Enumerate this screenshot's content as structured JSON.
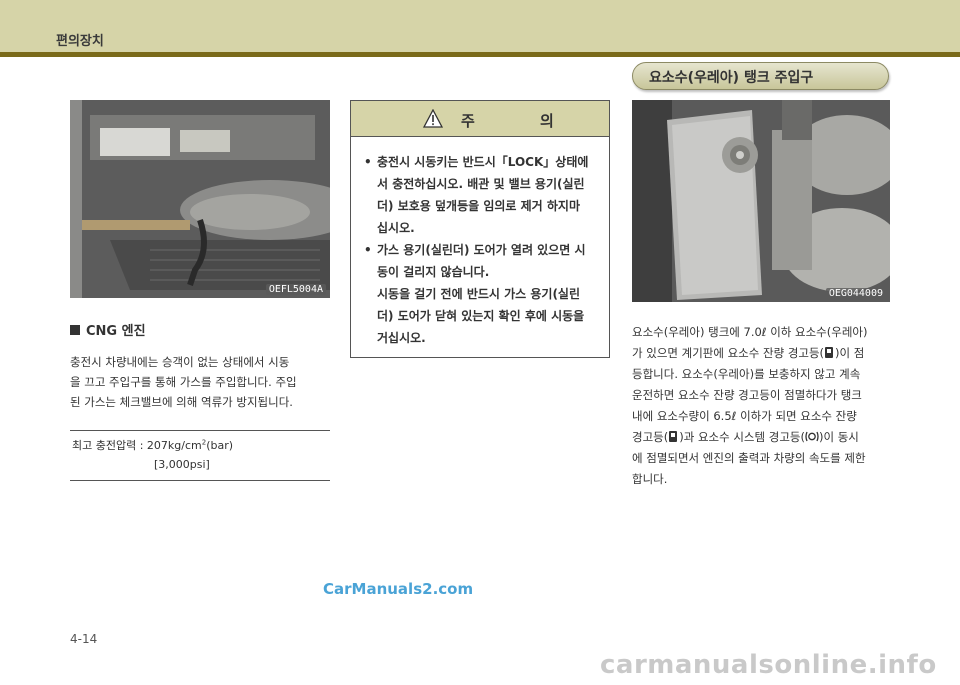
{
  "header": {
    "title": "편의장치"
  },
  "left_column": {
    "photo_code": "OEFL5004A",
    "section_heading": "CNG 엔진",
    "paragraph_lines": [
      "충전시 차량내에는 승객이 없는 상태에서 시동",
      "을 끄고 주입구를 통해 가스를 주입합니다. 주입",
      "된 가스는 체크밸브에 의해 역류가 방지됩니다."
    ],
    "pressure": {
      "label": "최고 충전압력 : 207kg/cm",
      "superscript": "2",
      "unit": "(bar)",
      "psi": "[3,000psi]"
    }
  },
  "caution": {
    "title": "주 의",
    "items": [
      {
        "bullet": true,
        "text": "충전시 시동키는 반드시「LOCK」상태에"
      },
      {
        "bullet": false,
        "text": "서 충전하십시오. 배관 및 밸브 용기(실린"
      },
      {
        "bullet": false,
        "text": "더) 보호용 덮개등을 임의로 제거 하지마"
      },
      {
        "bullet": false,
        "text": "십시오."
      },
      {
        "bullet": true,
        "text": "가스 용기(실린더) 도어가 열려 있으면 시"
      },
      {
        "bullet": false,
        "text": "동이 걸리지 않습니다."
      },
      {
        "bullet": false,
        "text": "시동을 걸기 전에 반드시 가스 용기(실린"
      },
      {
        "bullet": false,
        "text": "더) 도어가 닫혀 있는지 확인 후에 시동을"
      },
      {
        "bullet": false,
        "text": "거십시오."
      }
    ]
  },
  "right_column": {
    "pill_title": "요소수(우레아) 탱크 주입구",
    "photo_code": "OEG044009",
    "paragraph": {
      "line1": "요소수(우레아) 탱크에 7.0ℓ 이하 요소수(우레아)",
      "line2_a": "가 있으면 계기판에 요소수 잔량 경고등(",
      "line2_b": ")이 점",
      "line3": "등합니다. 요소수(우레아)를 보충하지 않고 계속",
      "line4": "운전하면 요소수 잔량 경고등이 점멸하다가 탱크",
      "line5": "내에 요소수량이 6.5ℓ 이하가 되면 요소수 잔량",
      "line6_a": "경고등(",
      "line6_b": ")과 요소수 시스템 경고등(",
      "line6_c": ")이 동시",
      "line7": "에 점멸되면서 엔진의 출력과 차량의 속도를 제한",
      "line8": "합니다."
    }
  },
  "footer": {
    "watermark_top": "CarManuals2.com",
    "page_number": "4-14",
    "watermark_bottom": "carmanualsonline.info"
  },
  "colors": {
    "header_band": "#d6d4a8",
    "header_line": "#7a6a1a",
    "watermark_blue": "#4aa3d6",
    "watermark_gray": "#c9c9c9"
  }
}
